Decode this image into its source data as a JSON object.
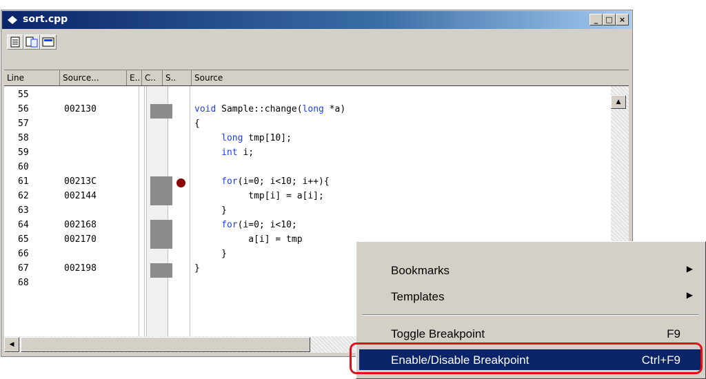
{
  "window": {
    "title": "sort.cpp",
    "buttons": {
      "minimize": "_",
      "maximize": "□",
      "close": "×"
    }
  },
  "toolbar": {
    "icons": [
      "source-view-icon",
      "mixed-view-icon",
      "disassembly-view-icon"
    ]
  },
  "columns": [
    "Line",
    "Source...",
    "E..",
    "C..",
    "S..",
    "Source"
  ],
  "code_rows": [
    {
      "line": "55",
      "address": "",
      "code": "",
      "kw": ""
    },
    {
      "line": "56",
      "address": "002130",
      "kw": "void",
      "code": " Sample::change(",
      "kw2": "long",
      "code2": " *a)"
    },
    {
      "line": "57",
      "address": "",
      "kw": "",
      "code": "{"
    },
    {
      "line": "58",
      "address": "",
      "kw": "     long",
      "code": " tmp[10];"
    },
    {
      "line": "59",
      "address": "",
      "kw": "     int",
      "code": " i;"
    },
    {
      "line": "60",
      "address": "",
      "kw": "",
      "code": ""
    },
    {
      "line": "61",
      "address": "00213C",
      "kw": "     for",
      "code": "(i=0; i<10; i++){"
    },
    {
      "line": "62",
      "address": "002144",
      "kw": "",
      "code": "          tmp[i] = a[i];"
    },
    {
      "line": "63",
      "address": "",
      "kw": "",
      "code": "     }"
    },
    {
      "line": "64",
      "address": "002168",
      "kw": "     for",
      "code": "(i=0; i<10;"
    },
    {
      "line": "65",
      "address": "002170",
      "kw": "",
      "code": "          a[i] = tmp"
    },
    {
      "line": "66",
      "address": "",
      "kw": "",
      "code": "     }"
    },
    {
      "line": "67",
      "address": "002198",
      "kw": "",
      "code": "}"
    },
    {
      "line": "68",
      "address": "",
      "kw": "",
      "code": ""
    }
  ],
  "breakpoint_line": "61",
  "context_menu": {
    "items": [
      {
        "label": "Bookmarks",
        "shortcut": "",
        "submenu": true
      },
      {
        "label": "Templates",
        "shortcut": "",
        "submenu": true
      },
      {
        "label": "Toggle Breakpoint",
        "shortcut": "F9",
        "submenu": false
      },
      {
        "label": "Enable/Disable Breakpoint",
        "shortcut": "Ctrl+F9",
        "submenu": false,
        "highlighted": true
      }
    ]
  },
  "colors": {
    "titlebar": "#0a246a",
    "keyword": "#1a3cff",
    "breakpoint": "#8b0000",
    "highlight_outline": "#e0101a"
  }
}
